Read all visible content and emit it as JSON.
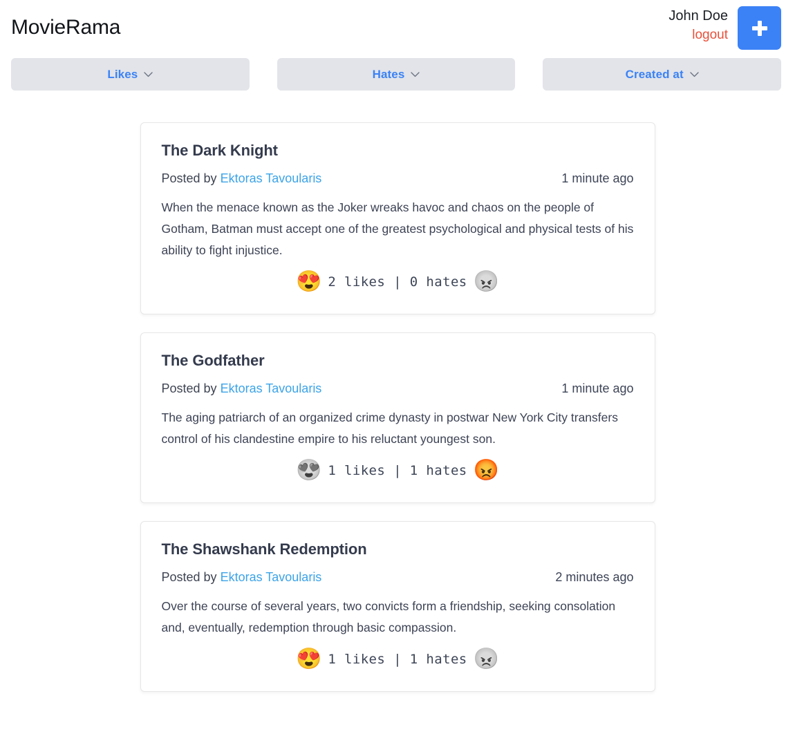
{
  "header": {
    "brand": "MovieRama",
    "user_name": "John Doe",
    "logout_label": "logout",
    "add_button_label": "+",
    "accent_blue": "#3b82f6",
    "logout_color": "#e8503a"
  },
  "filters": [
    {
      "label": "Likes",
      "icon": "chevron-down-icon"
    },
    {
      "label": "Hates",
      "icon": "chevron-down-icon"
    },
    {
      "label": "Created at",
      "icon": "chevron-down-icon"
    }
  ],
  "movies": [
    {
      "title": "The Dark Knight",
      "posted_by_prefix": "Posted by",
      "author": "Ektoras Tavoularis",
      "timestamp": "1 minute ago",
      "description": "When the menace known as the Joker wreaks havoc and chaos on the people of Gotham, Batman must accept one of the greatest psychological and physical tests of his ability to fight injustice.",
      "like_emoji": "😍",
      "like_state": "active",
      "hate_emoji": "😠",
      "hate_state": "inactive",
      "counts": "2 likes | 0 hates",
      "likes": 2,
      "hates": 0
    },
    {
      "title": "The Godfather",
      "posted_by_prefix": "Posted by",
      "author": "Ektoras Tavoularis",
      "timestamp": "1 minute ago",
      "description": "The aging patriarch of an organized crime dynasty in postwar New York City transfers control of his clandestine empire to his reluctant youngest son.",
      "like_emoji": "😍",
      "like_state": "inactive",
      "hate_emoji": "😡",
      "hate_state": "active",
      "counts": "1 likes | 1 hates",
      "likes": 1,
      "hates": 1
    },
    {
      "title": "The Shawshank Redemption",
      "posted_by_prefix": "Posted by",
      "author": "Ektoras Tavoularis",
      "timestamp": "2 minutes ago",
      "description": "Over the course of several years, two convicts form a friendship, seeking consolation and, eventually, redemption through basic compassion.",
      "like_emoji": "😍",
      "like_state": "active",
      "hate_emoji": "😠",
      "hate_state": "inactive",
      "counts": "1 likes | 1 hates",
      "likes": 1,
      "hates": 1
    }
  ]
}
